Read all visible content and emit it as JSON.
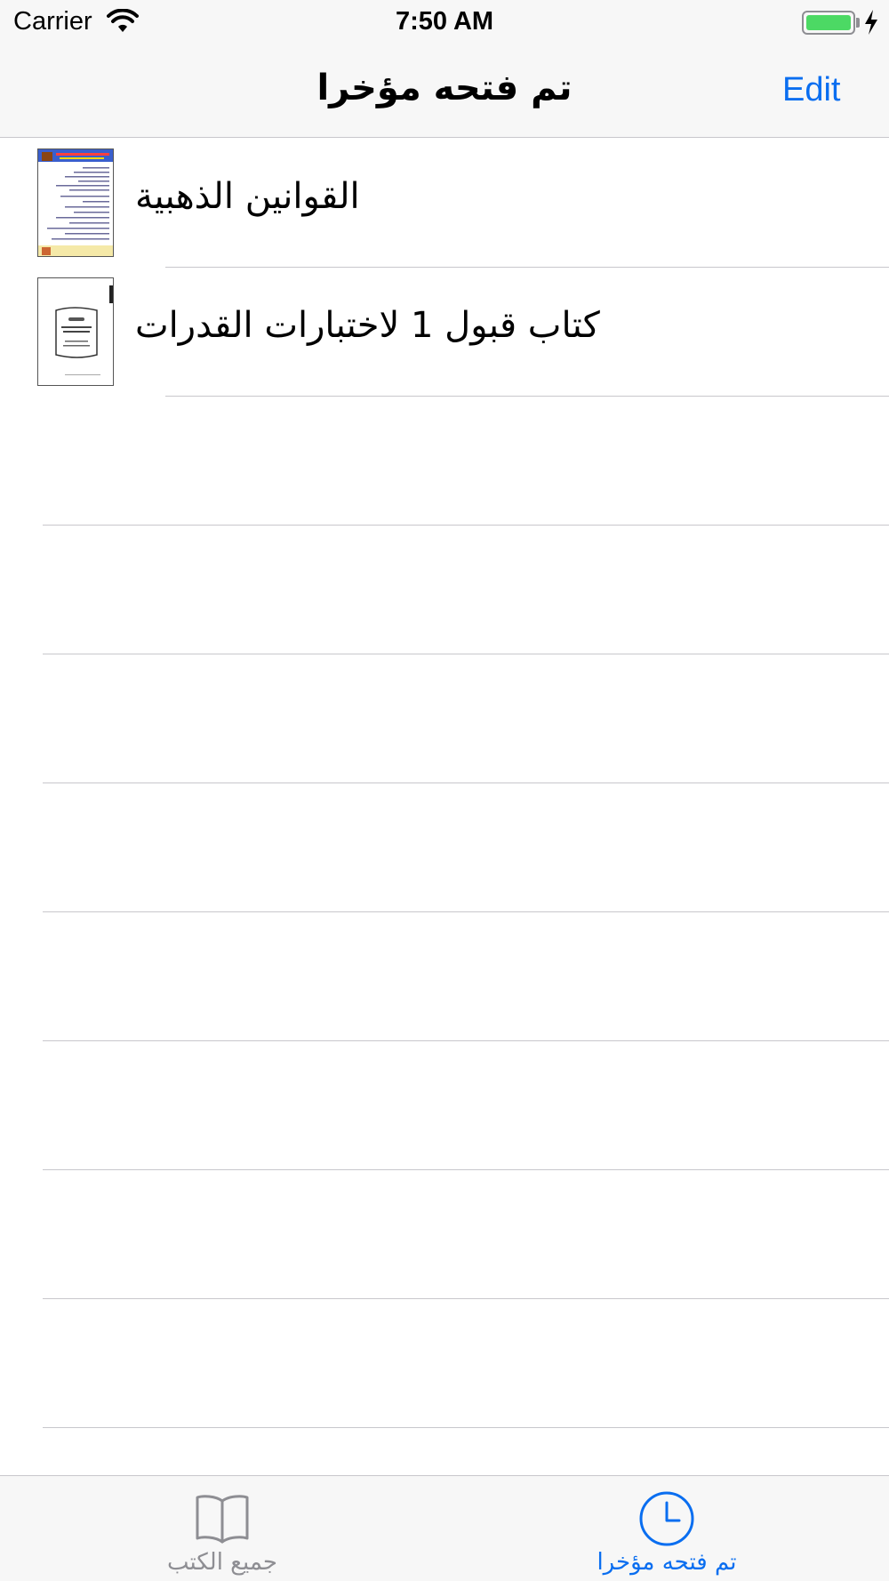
{
  "status_bar": {
    "carrier": "Carrier",
    "time": "7:50 AM",
    "wifi_icon": "wifi-icon",
    "battery_icon": "battery-icon",
    "charging_icon": "bolt-icon",
    "battery_color": "#4cd964"
  },
  "nav": {
    "title": "تم فتحه مؤخرا",
    "edit_label": "Edit",
    "accent_color": "#0a6ef0"
  },
  "books": [
    {
      "title": "القوانين الذهبية",
      "thumbnail_icon": "book-cover-thumbnail"
    },
    {
      "title": "كتاب قبول 1 لاختبارات القدرات",
      "thumbnail_icon": "book-cover-thumbnail"
    }
  ],
  "tabs": [
    {
      "label": "جميع الكتب",
      "icon": "book-icon",
      "selected": false
    },
    {
      "label": "تم فتحه مؤخرا",
      "icon": "clock-icon",
      "selected": true
    }
  ]
}
